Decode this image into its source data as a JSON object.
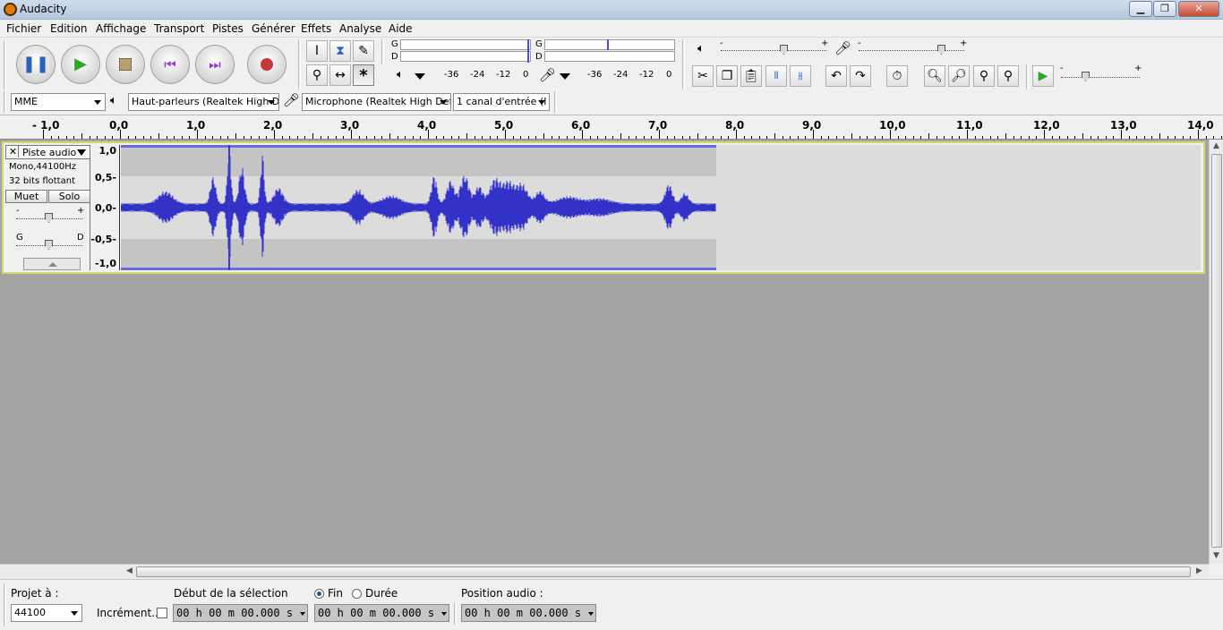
{
  "window": {
    "title": "Audacity"
  },
  "menu": [
    "Fichier",
    "Edition",
    "Affichage",
    "Transport",
    "Pistes",
    "Générer",
    "Effets",
    "Analyse",
    "Aide"
  ],
  "meters": {
    "play_left": "G",
    "play_right": "D",
    "rec_left": "G",
    "rec_right": "D",
    "scale": [
      "-36",
      "-24",
      "-12",
      "0"
    ]
  },
  "slider_marks": {
    "minus": "-",
    "plus": "+"
  },
  "device": {
    "host": "MME",
    "output": "Haut-parleurs (Realtek High De",
    "input": "Microphone (Realtek High Defi",
    "channels": "1 canal d'entrée (I"
  },
  "ruler": {
    "labels": [
      "- 1,0",
      "0,0",
      "1,0",
      "2,0",
      "3,0",
      "4,0",
      "5,0",
      "6,0",
      "7,0",
      "8,0",
      "9,0",
      "10,0",
      "11,0",
      "12,0",
      "13,0",
      "14,0"
    ]
  },
  "track": {
    "name": "Piste audio",
    "info1": "Mono,44100Hz",
    "info2": "32 bits flottant",
    "mute": "Muet",
    "solo": "Solo",
    "gain_minus": "-",
    "gain_plus": "+",
    "pan_left": "G",
    "pan_right": "D",
    "scale": [
      "1,0",
      "0,5-",
      "0,0-",
      "-0,5-",
      "-1,0"
    ]
  },
  "selection": {
    "project_rate_label": "Projet à :",
    "project_rate": "44100",
    "snap_label": "Incrément...",
    "start_label": "Début de la sélection",
    "end_label": "Fin",
    "length_label": "Durée",
    "audio_position_label": "Position audio :",
    "start_time": "00 h 00 m 00.000 s",
    "end_time": "00 h 00 m 00.000 s",
    "audio_position": "00 h 00 m 00.000 s"
  },
  "colors": {
    "waveform": "#3232c8",
    "selection_border": "#d8d870"
  }
}
